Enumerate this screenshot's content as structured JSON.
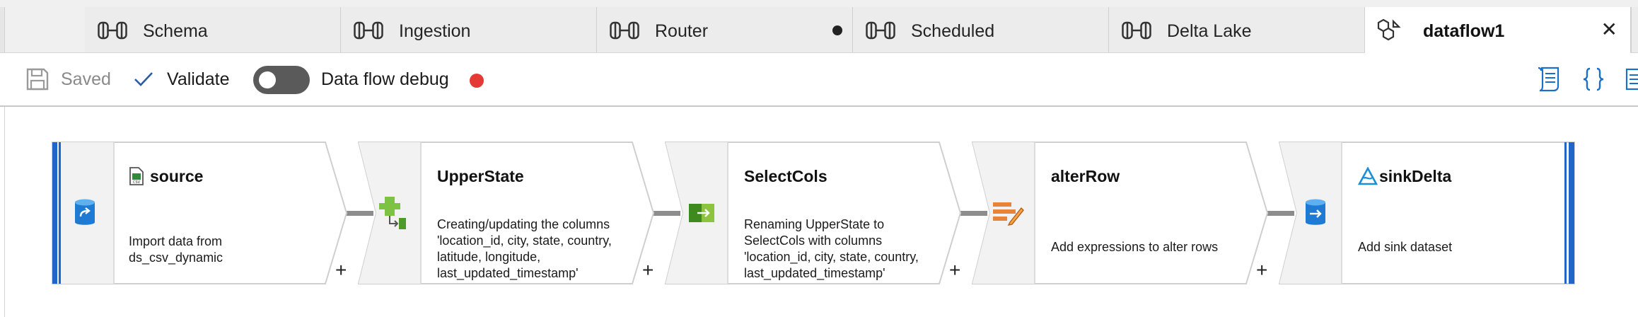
{
  "tabs": [
    {
      "label": "Schema"
    },
    {
      "label": "Ingestion"
    },
    {
      "label": "Router"
    },
    {
      "label": "Scheduled"
    },
    {
      "label": "Delta Lake"
    },
    {
      "label": "dataflow1"
    }
  ],
  "toolbar": {
    "saved_label": "Saved",
    "validate_label": "Validate",
    "debug_label": "Data flow debug",
    "debug_enabled": false
  },
  "colors": {
    "accent": "#0f6cbd",
    "debug_status": "#e53935",
    "connector": "#8c8c8c"
  },
  "nodes": [
    {
      "title": "source",
      "description": "Import data from\nds_csv_dynamic"
    },
    {
      "title": "UpperState",
      "description": "Creating/updating the columns\n'location_id, city, state, country,\nlatitude, longitude,\nlast_updated_timestamp'"
    },
    {
      "title": "SelectCols",
      "description": "Renaming UpperState to\nSelectCols with columns\n'location_id, city, state, country,\nlast_updated_timestamp'"
    },
    {
      "title": "alterRow",
      "description": "Add expressions to alter rows"
    },
    {
      "title": "sinkDelta",
      "description": "Add sink dataset"
    }
  ],
  "add_symbol": "+",
  "close_symbol": "✕"
}
